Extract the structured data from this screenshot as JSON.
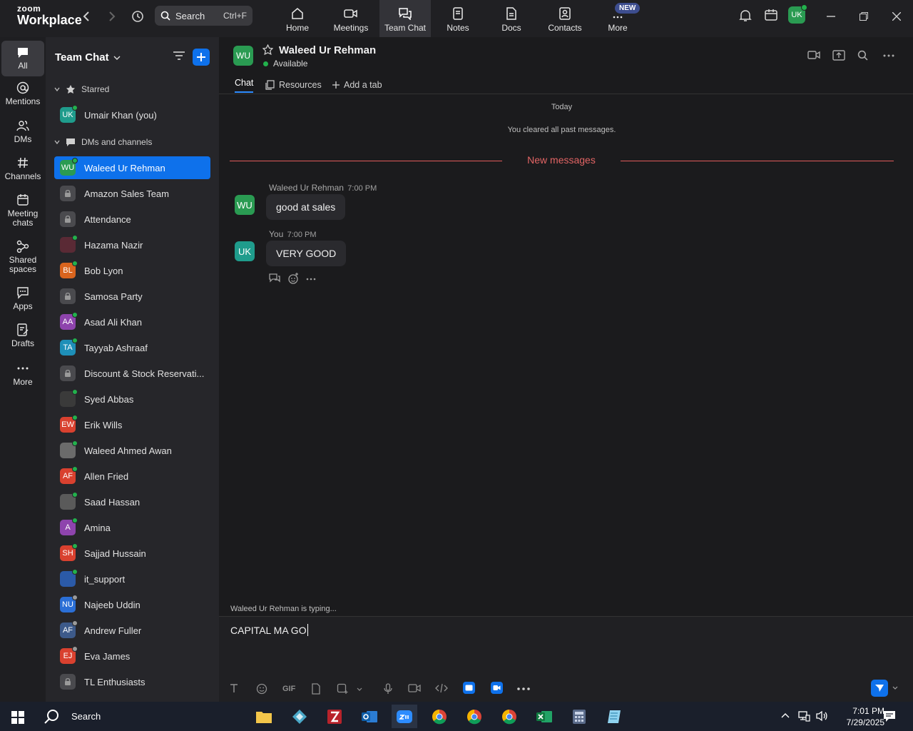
{
  "app": {
    "logo_line1": "zoom",
    "logo_line2": "Workplace"
  },
  "search": {
    "placeholder": "Search",
    "shortcut": "Ctrl+F"
  },
  "topnav": [
    {
      "label": "Home",
      "icon": "home-icon"
    },
    {
      "label": "Meetings",
      "icon": "video-camera-icon"
    },
    {
      "label": "Team Chat",
      "icon": "chat-icon",
      "active": true
    },
    {
      "label": "Notes",
      "icon": "notes-icon"
    },
    {
      "label": "Docs",
      "icon": "docs-icon"
    },
    {
      "label": "Contacts",
      "icon": "contacts-icon"
    },
    {
      "label": "More",
      "icon": "more-icon"
    }
  ],
  "new_badge": "NEW",
  "profile": {
    "initials": "UK",
    "color": "#2a9b52"
  },
  "rail": [
    {
      "label": "All",
      "icon": "chat-bubble-icon",
      "active": true
    },
    {
      "label": "Mentions",
      "icon": "at-icon"
    },
    {
      "label": "DMs",
      "icon": "people-icon"
    },
    {
      "label": "Channels",
      "icon": "hash-icon"
    },
    {
      "label": "Meeting chats",
      "icon": "calendar-icon"
    },
    {
      "label": "Shared spaces",
      "icon": "share-icon"
    },
    {
      "label": "Apps",
      "icon": "apps-icon"
    },
    {
      "label": "Drafts",
      "icon": "drafts-icon"
    },
    {
      "label": "More",
      "icon": "ellipsis-icon"
    }
  ],
  "sidebar": {
    "title": "Team Chat",
    "starred_label": "Starred",
    "starred": [
      {
        "name": "Umair Khan (you)",
        "initials": "UK",
        "color": "#1f9c8c",
        "online": true
      }
    ],
    "dms_label": "DMs and channels",
    "items": [
      {
        "name": "Waleed Ur Rehman",
        "initials": "WU",
        "color": "#2a9b52",
        "online": true,
        "selected": true
      },
      {
        "name": "Amazon Sales Team",
        "initials": "",
        "color": "#4a4a4e",
        "lock": true
      },
      {
        "name": "Attendance",
        "initials": "",
        "color": "#4a4a4e",
        "lock": true
      },
      {
        "name": "Hazama Nazir",
        "initials": "",
        "color": "#5a2a35",
        "online": true
      },
      {
        "name": "Bob Lyon",
        "initials": "BL",
        "color": "#d9641e",
        "online": true
      },
      {
        "name": "Samosa Party",
        "initials": "",
        "color": "#4a4a4e",
        "lock": true
      },
      {
        "name": "Asad Ali Khan",
        "initials": "AA",
        "color": "#8e44ad",
        "online": true
      },
      {
        "name": "Tayyab Ashraaf",
        "initials": "TA",
        "color": "#1e8fb8",
        "online": true
      },
      {
        "name": "Discount & Stock Reservati...",
        "initials": "",
        "color": "#4a4a4e",
        "lock": true
      },
      {
        "name": "Syed Abbas",
        "initials": "",
        "color": "#3a3a3a",
        "online": true
      },
      {
        "name": "Erik Wills",
        "initials": "EW",
        "color": "#d9412f",
        "online": true
      },
      {
        "name": "Waleed Ahmed Awan",
        "initials": "",
        "color": "#6b6b6b",
        "online": true
      },
      {
        "name": "Allen Fried",
        "initials": "AF",
        "color": "#d9412f",
        "online": true
      },
      {
        "name": "Saad Hassan",
        "initials": "",
        "color": "#5a5a5a",
        "online": true
      },
      {
        "name": "Amina",
        "initials": "A",
        "color": "#8e44ad",
        "online": true
      },
      {
        "name": "Sajjad Hussain",
        "initials": "SH",
        "color": "#d9412f",
        "online": true
      },
      {
        "name": "it_support",
        "initials": "",
        "color": "#2b5aa8",
        "online": true
      },
      {
        "name": "Najeeb Uddin",
        "initials": "NU",
        "color": "#2b6fd6",
        "online": false
      },
      {
        "name": "Andrew Fuller",
        "initials": "AF",
        "color": "#3d5a8a",
        "online": false
      },
      {
        "name": "Eva James",
        "initials": "EJ",
        "color": "#d9412f",
        "online": false
      },
      {
        "name": "TL Enthusiasts",
        "initials": "",
        "color": "#4a4a4e",
        "lock": true
      }
    ]
  },
  "chat": {
    "contact_initials": "WU",
    "contact_name": "Waleed Ur Rehman",
    "status": "Available",
    "tabs": [
      "Chat",
      "Resources",
      "Add a tab"
    ],
    "today": "Today",
    "cleared": "You cleared all past messages.",
    "new_messages": "New messages",
    "messages": [
      {
        "sender": "Waleed Ur Rehman",
        "time": "7:00 PM",
        "text": "good at sales",
        "initials": "WU",
        "color": "#2a9b52"
      },
      {
        "sender": "You",
        "time": "7:00 PM",
        "text": "VERY GOOD",
        "initials": "UK",
        "color": "#1f9c8c"
      }
    ],
    "typing": "Waleed Ur Rehman  is typing...",
    "draft": "CAPITAL MA GO",
    "gif_label": "GIF"
  },
  "taskbar": {
    "search": "Search",
    "time": "7:01 PM",
    "date": "7/29/2025"
  }
}
